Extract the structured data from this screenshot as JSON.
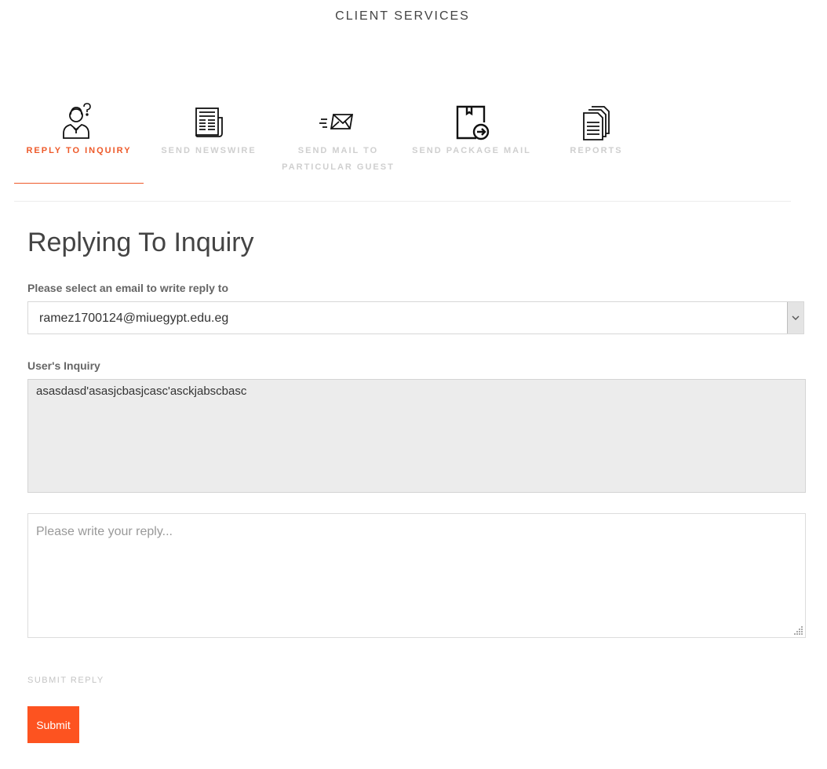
{
  "header": {
    "title": "CLIENT SERVICES"
  },
  "tabs": [
    {
      "label": "REPLY TO INQUIRY",
      "icon": "support-agent-icon",
      "active": true
    },
    {
      "label": "SEND NEWSWIRE",
      "icon": "newspaper-icon",
      "active": false
    },
    {
      "label": "SEND MAIL TO PARTICULAR GUEST",
      "icon": "send-mail-icon",
      "active": false
    },
    {
      "label": "SEND PACKAGE MAIL",
      "icon": "package-mail-icon",
      "active": false
    },
    {
      "label": "REPORTS",
      "icon": "reports-icon",
      "active": false
    }
  ],
  "main": {
    "heading": "Replying To Inquiry",
    "email_label": "Please select an email to write reply to",
    "email_selected": "ramez1700124@miuegypt.edu.eg",
    "inquiry_label": "User's Inquiry",
    "inquiry_text": "asasdasd'asasjcbasjcasc'asckjabscbasc",
    "reply_placeholder": "Please write your reply...",
    "submit_caption": "SUBMIT REPLY",
    "submit_label": "Submit"
  },
  "colors": {
    "accent": "#fd5320",
    "tab_active": "#ee5a2a",
    "tab_inactive": "#cfcfcf",
    "inquiry_bg": "#ececec"
  }
}
